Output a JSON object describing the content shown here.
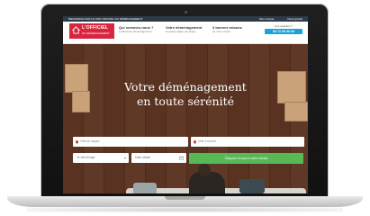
{
  "top_strip": {
    "left_text": "BIENVENUE SUR LE SITE OFFICIEL DU DÉMÉNAGEMENT",
    "right_links": [
      "Mon compte",
      "Devis gratuit"
    ]
  },
  "header": {
    "logo": {
      "line1": "L'OFFICIEL",
      "line2": "DU DÉMÉNAGEMENT"
    },
    "nav": [
      {
        "title": "Qui sommes-nous ?",
        "subtitle": "L'officiel du déménagement"
      },
      {
        "title": "Votre déménagement",
        "subtitle": "Conseils étape par étape"
      },
      {
        "title": "3 bonnes raisons",
        "subtitle": "de nous choisir"
      }
    ],
    "phone": {
      "label": "Une question ?",
      "number": "09 72 00 00 00"
    }
  },
  "hero": {
    "title_line1": "Votre déménagement",
    "title_line2": "en toute sérénité",
    "form": {
      "departure_placeholder": "Ville de départ",
      "arrival_placeholder": "Ville d'arrivée",
      "move_type": "Je déménage",
      "date_placeholder": "Date idéale",
      "submit_label": "Cliquez ici pour votre devis"
    }
  },
  "colors": {
    "accent_red": "#d7263d",
    "accent_blue": "#1aa3d9",
    "cta_green": "#57b857",
    "dark_strip": "#2d3a47"
  }
}
